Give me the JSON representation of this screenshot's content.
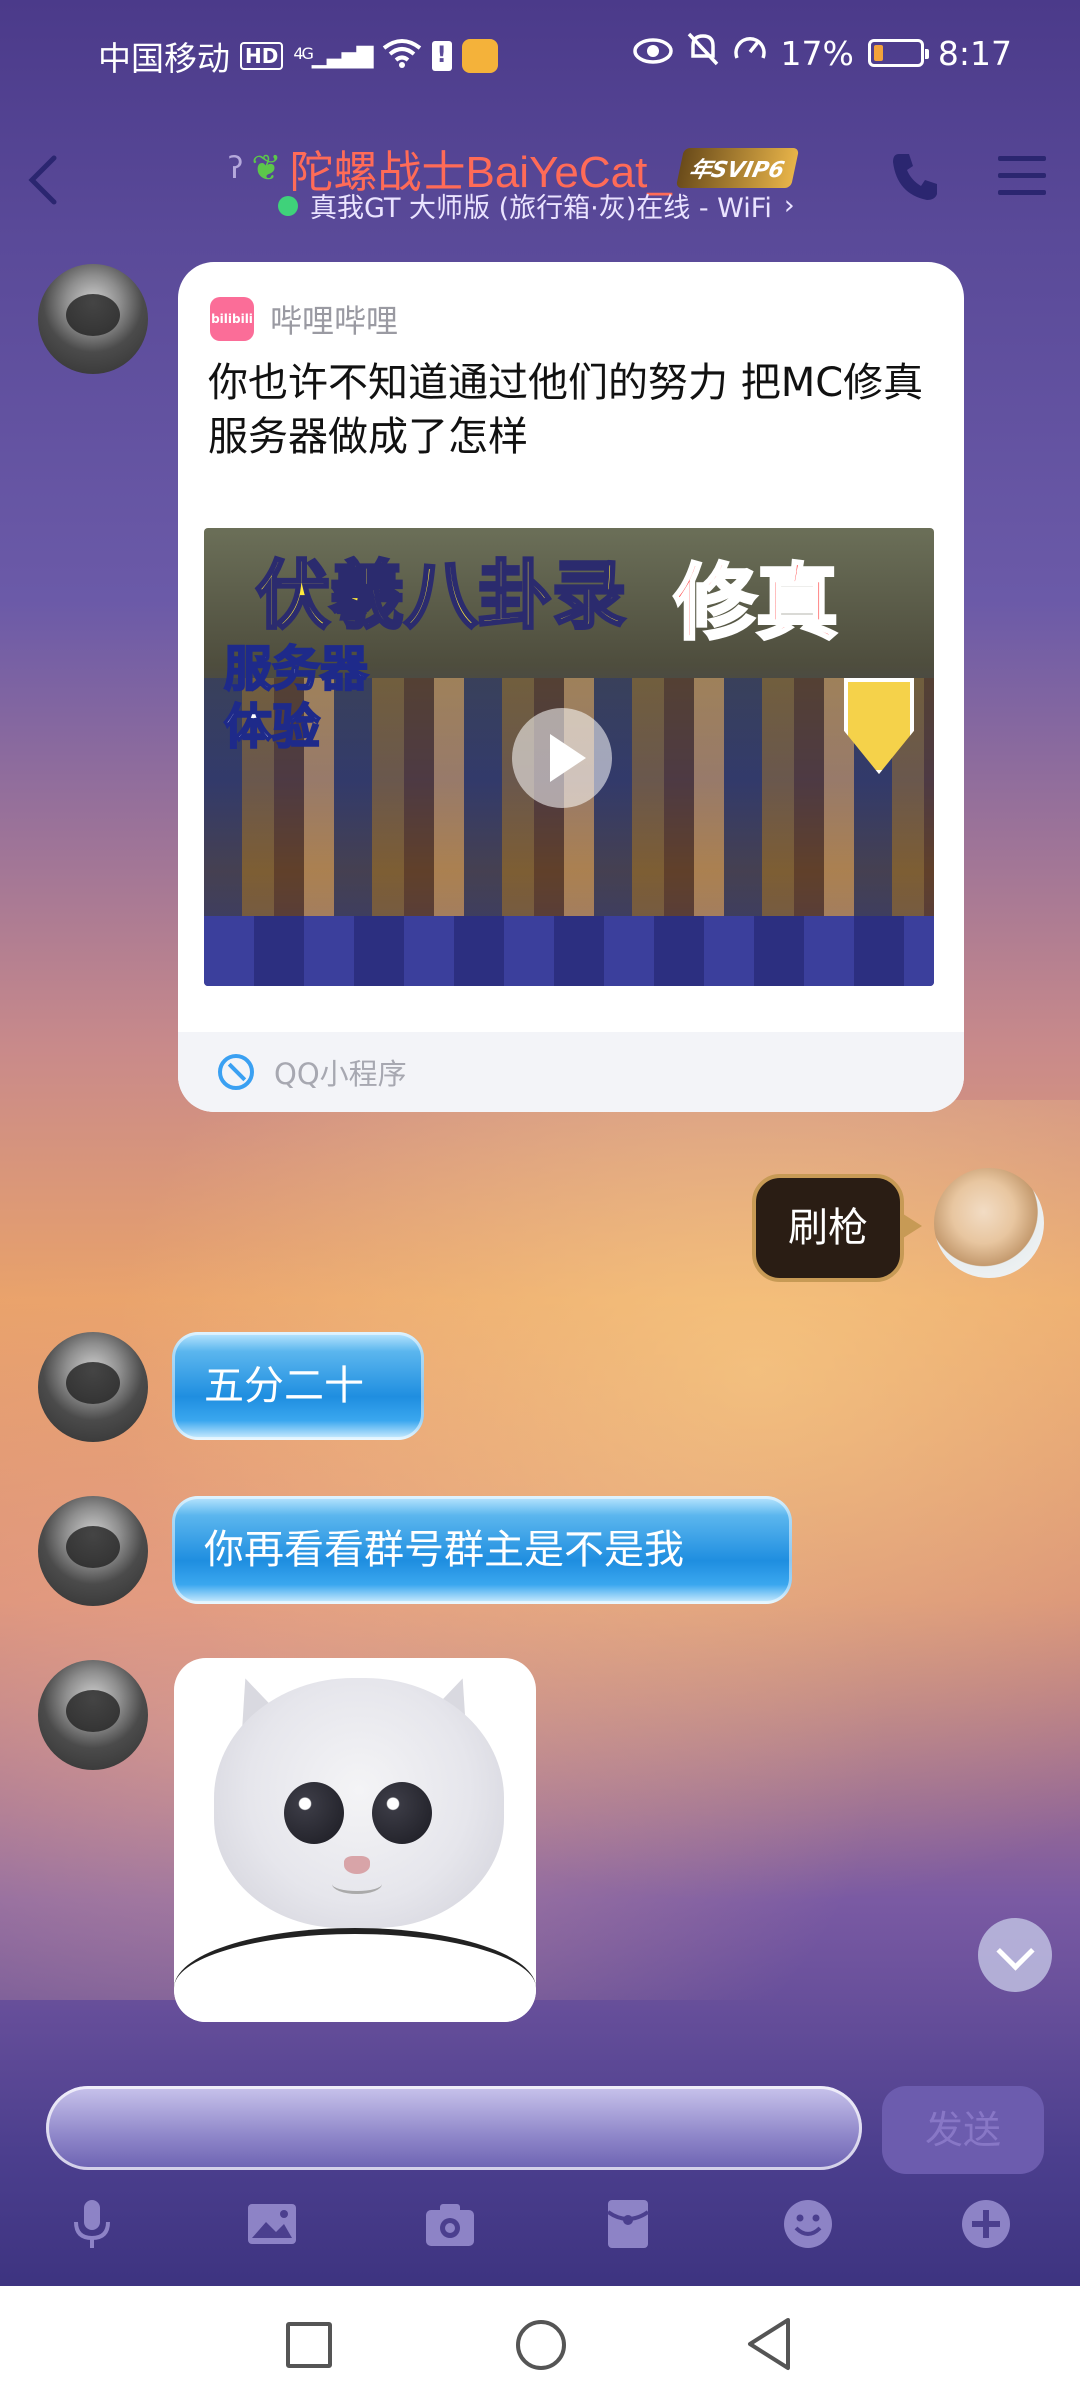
{
  "status_bar": {
    "carrier": "中国移动",
    "hd": "HD",
    "network": "4G",
    "battery_percent": "17%",
    "time": "8:17"
  },
  "header": {
    "nickname": "陀螺战士BaiYeCat_",
    "badge": "年SVIP6",
    "status_line": "真我GT 大师版 (旅行箱·灰)在线 - WiFi",
    "chevron": "›"
  },
  "messages": {
    "card": {
      "source": "哔哩哔哩",
      "bili_logo_text": "bilibili",
      "title": "你也许不知道通过他们的努力 把MC修真服务器做成了怎样",
      "thumb_text_1": "伏羲八卦录",
      "thumb_text_2": "修真",
      "thumb_text_3": "服务器 体验",
      "footer": "QQ小程序"
    },
    "me_1": "刷枪",
    "other_1": "五分二十",
    "other_2": "你再看看群号群主是不是我"
  },
  "input": {
    "placeholder": "",
    "send_label": "发送"
  },
  "colors": {
    "nickname": "#ff6b57",
    "online_dot": "#3fd27a",
    "accent": "#5a4a99"
  },
  "icons": {
    "toolbar": [
      "mic-icon",
      "image-icon",
      "camera-icon",
      "red-packet-icon",
      "emoji-icon",
      "plus-icon"
    ]
  }
}
